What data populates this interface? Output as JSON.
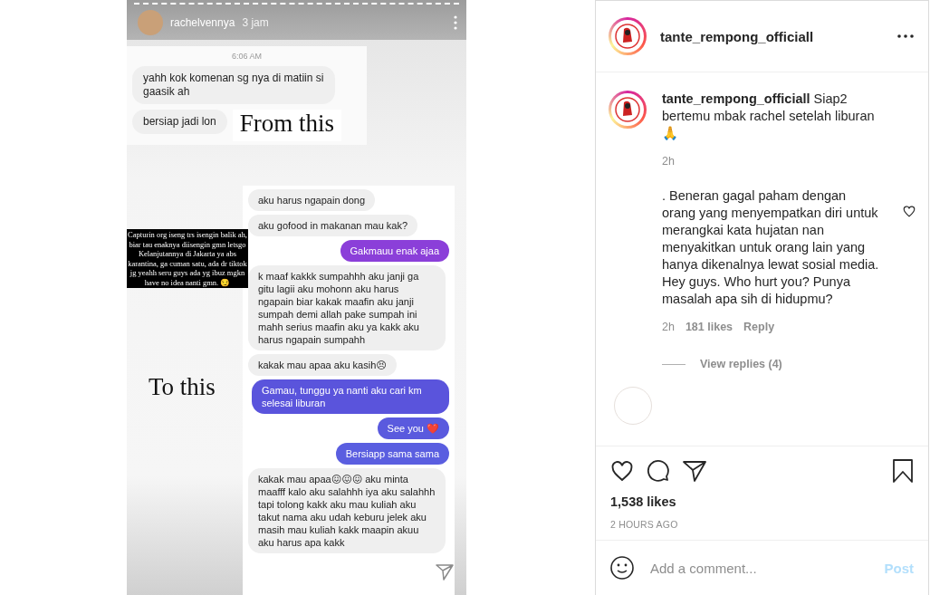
{
  "story": {
    "username": "rachelvennya",
    "time": "3 jam",
    "timestamp": "6:06 AM",
    "first_chat": [
      {
        "text": "yahh kok komenan sg nya di matiin si gaasik ah"
      },
      {
        "text": "bersiap jadi lon"
      }
    ],
    "from_label": "From this",
    "to_label": "To this",
    "caption": "Capturin org iseng trs isengin balik ah, biar tau enaknya diisengin gmn letsgo Kelanjutannya di Jakarta ya abs karantina, ga cuman satu, ada dr tiktok jg yeahh seru guys ada yg ibuz mgkn have no idea nanti gmn. 😏",
    "messages": [
      {
        "kind": "received",
        "color": "#efefef",
        "text": "aku harus ngapain dong"
      },
      {
        "kind": "received",
        "color": "#efefef",
        "text": "aku gofood in makanan mau kak?"
      },
      {
        "kind": "sent",
        "color": "#8b3fd9",
        "text": "Gakmauu enak ajaa"
      },
      {
        "kind": "received",
        "color": "#efefef",
        "text": "k maaf kakkk sumpahhh aku janji ga gitu lagii aku mohonn aku harus ngapain biar kakak maafin aku janji sumpah demi allah pake sumpah ini mahh serius maafin aku ya kakk aku harus ngapain sumpahh"
      },
      {
        "kind": "received",
        "color": "#efefef",
        "text": "kakak mau apaa aku kasih😣"
      },
      {
        "kind": "sent",
        "color": "#5a54dc",
        "text": "Gamau, tunggu ya nanti aku cari km selesai liburan"
      },
      {
        "kind": "sent",
        "color": "#5a5ade",
        "text": "See you ❤️"
      },
      {
        "kind": "sent",
        "color": "#5a5ee0",
        "text": "Bersiapp sama sama"
      },
      {
        "kind": "received",
        "color": "#efefef",
        "text": "kakak mau apaa😖😖😖 aku minta maafff kalo aku salahhh iya aku salahhh tapi tolong kakk aku mau kuliah aku takut nama aku udah keburu jelek aku masih mau kuliah kakk maapin akuu aku harus apa kakk"
      }
    ]
  },
  "post": {
    "username": "tante_rempong_officiall",
    "caption": {
      "username": "tante_rempong_officiall",
      "text": "Siap2 bertemu mbak rachel setelah liburan 🙏",
      "time": "2h"
    },
    "comments": [
      {
        "text": ". Beneran gagal paham dengan orang yang menyempatkan diri untuk merangkai kata hujatan nan menyakitkan untuk orang lain yang hanya dikenalnya lewat sosial media. Hey guys. Who hurt you? Punya masalah apa sih di hidupmu?",
        "time": "2h",
        "likes": "181 likes",
        "reply": "Reply",
        "view_replies": "View replies (4)"
      }
    ],
    "likes": "1,538 likes",
    "time_ago": "2 HOURS AGO",
    "comment_placeholder": "Add a comment...",
    "post_button": {
      "label": "Post",
      "disabled": true
    }
  }
}
